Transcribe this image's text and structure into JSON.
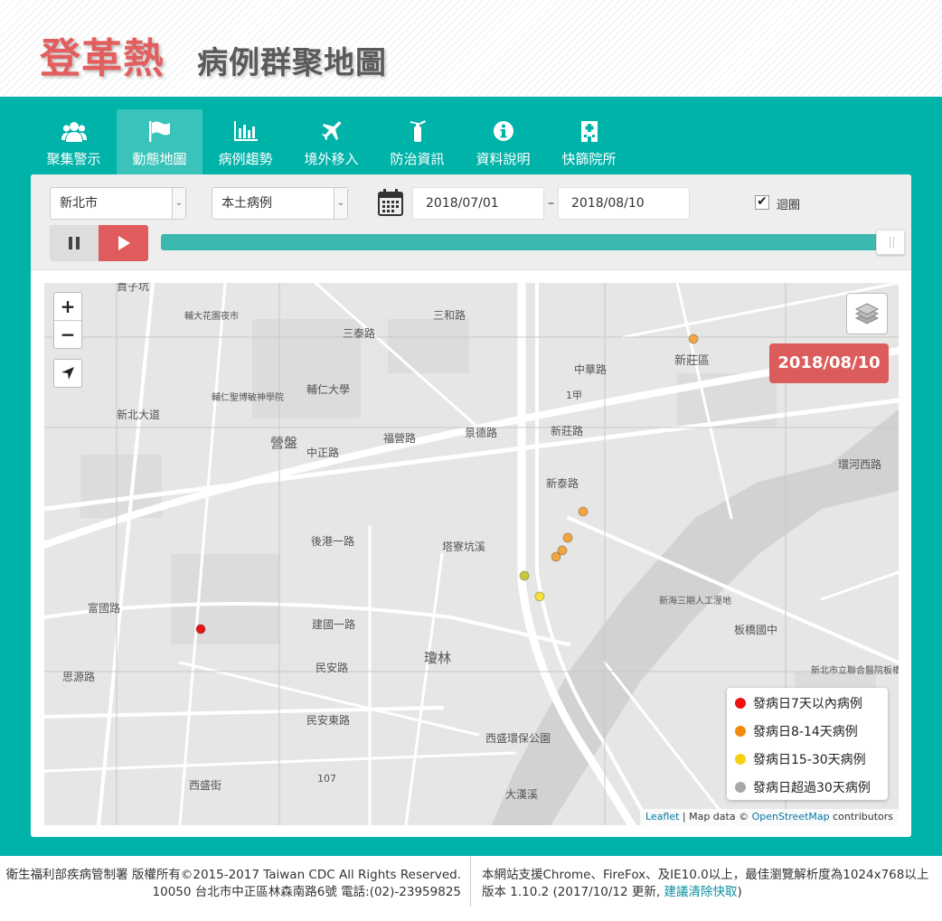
{
  "header": {
    "title_main": "登革熱",
    "title_sub": "病例群聚地圖"
  },
  "nav": {
    "items": [
      {
        "label": "聚集警示",
        "icon": "users-icon"
      },
      {
        "label": "動態地圖",
        "icon": "flag-icon",
        "active": true
      },
      {
        "label": "病例趨勢",
        "icon": "bar-chart-icon"
      },
      {
        "label": "境外移入",
        "icon": "plane-icon"
      },
      {
        "label": "防治資訊",
        "icon": "fire-extinguisher-icon"
      },
      {
        "label": "資料說明",
        "icon": "info-icon"
      },
      {
        "label": "快篩院所",
        "icon": "hospital-icon"
      }
    ]
  },
  "controls": {
    "city": "新北市",
    "case_type": "本土病例",
    "date_start": "2018/07/01",
    "date_end": "2018/08/10",
    "date_sep": "–",
    "loop_label": "迴圈",
    "loop_checked": true,
    "slider_fraction": 1.0
  },
  "map": {
    "current_date": "2018/08/10",
    "zoom_in": "+",
    "zoom_out": "−",
    "labels": {
      "l1": "營盤",
      "l2": "瓊林",
      "l3": "新莊區",
      "l4": "中正路",
      "l5": "新莊路",
      "l6": "福營路",
      "l7": "景德路",
      "l8": "民安路",
      "l9": "民安東路",
      "l10": "後港一路",
      "l11": "建國一路",
      "l12": "中華路",
      "l13": "輔仁大學",
      "l14": "西盛環保公園",
      "l15": "大漢溪",
      "l16": "板橋國中",
      "l17": "新北市立聯合醫院板橋院區",
      "l18": "107",
      "l19": "1甲",
      "l20": "富國路",
      "l21": "思源路",
      "l22": "新北大道",
      "l23": "三泰路",
      "l24": "西盛街",
      "l25": "三和路",
      "l26": "輔仁聖博敏神學院",
      "l27": "新海三期人工溼地",
      "l28": "貴子坑",
      "l29": "塔寮坑溪",
      "l30": "環河西路",
      "l31": "輔大花園夜市",
      "l32": "新泰路"
    },
    "legend": [
      {
        "label": "發病日7天以內病例",
        "color": "#ee1111"
      },
      {
        "label": "發病日8-14天病例",
        "color": "#f28a0c"
      },
      {
        "label": "發病日15-30天病例",
        "color": "#f5d10f"
      },
      {
        "label": "發病日超過30天病例",
        "color": "#a8a8a8"
      }
    ],
    "cases": [
      {
        "category": "發病日7天以內病例",
        "color": "#ee1111"
      },
      {
        "category": "發病日8-14天病例",
        "color": "#f2a440"
      },
      {
        "category": "發病日8-14天病例",
        "color": "#f2a440"
      },
      {
        "category": "發病日8-14天病例",
        "color": "#f2a440"
      },
      {
        "category": "發病日8-14天病例",
        "color": "#f2a440"
      },
      {
        "category": "發病日8-14天病例",
        "color": "#f2a440"
      },
      {
        "category": "發病日15-30天病例",
        "color": "#f4e13a"
      },
      {
        "category": "發病日15-30天病例",
        "color": "#c8c83a"
      }
    ],
    "attribution": {
      "leaflet": "Leaflet",
      "sep": " | Map data © ",
      "osm": "OpenStreetMap",
      "suffix": " contributors"
    }
  },
  "footer": {
    "left_line1": "衛生福利部疾病管制署 版權所有©2015-2017 Taiwan CDC All Rights Reserved.",
    "left_line2": "10050 台北市中正區林森南路6號 電話:(02)-23959825",
    "right_line1": "本網站支援Chrome、FireFox、及IE10.0以上，最佳瀏覽解析度為1024x768以上",
    "right_line2_prefix": "版本 1.10.2 (2017/10/12 更新, ",
    "right_line2_link": "建議清除快取",
    "right_line2_suffix": ")"
  }
}
